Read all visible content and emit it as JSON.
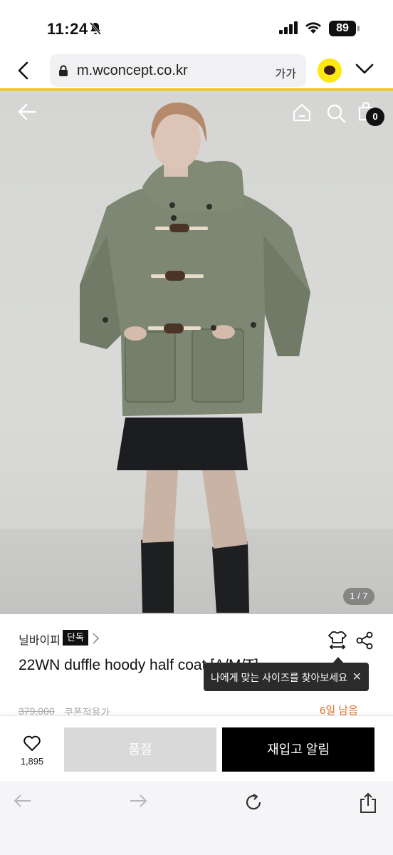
{
  "status_bar": {
    "time": "11:24",
    "battery": "89"
  },
  "browser": {
    "url": "m.wconcept.co.kr",
    "text_size_label": "가가"
  },
  "gallery": {
    "indicator": "1 / 7",
    "cart_count": "0"
  },
  "product": {
    "brand": "닐바이피",
    "exclusive_badge": "단독",
    "title": "22WN duffle hoody half coat [A/M/T]",
    "original_price": "379,000",
    "coupon_label": "쿠폰적용가",
    "days_left": "6일 남음"
  },
  "tooltip": {
    "text": "나에게 맞는 사이즈를 찾아보세요"
  },
  "actions": {
    "like_count": "1,895",
    "soldout_label": "품절",
    "restock_label": "재입고 알림"
  },
  "colors": {
    "accent_yellow": "#f2c200",
    "kakao_yellow": "#ffe812",
    "days_left_orange": "#e3712c"
  }
}
